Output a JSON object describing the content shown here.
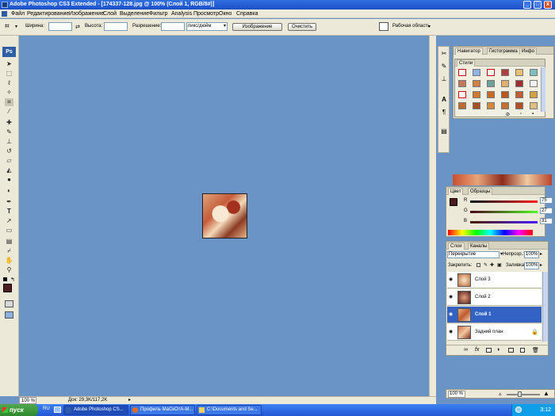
{
  "window": {
    "title": "Adobe Photoshop CS3 Extended - [174337-128.jpg @ 100% (Слой 1, RGB/8#)]",
    "minimize": "_",
    "maximize": "□",
    "close": "x"
  },
  "menu": [
    "Файл",
    "Редактирование",
    "Изображение",
    "Слой",
    "Выделение",
    "Фильтр",
    "Analysis",
    "Просмотр",
    "Окно",
    "Справка"
  ],
  "options": {
    "width_label": "Ширина:",
    "height_label": "Высота:",
    "resolution_label": "Разрешение:",
    "units": "пикс/дюйм",
    "image_button": "Изображение",
    "clear_button": "Очистить",
    "workspace": "Рабочая область"
  },
  "toolbox": {
    "logo": "Ps"
  },
  "status": {
    "zoom": "100 %",
    "doc": "Док: 29,3K/117,2K"
  },
  "navigator": {
    "tabs": [
      "Навигатор",
      "Гистограмма",
      "Инфо"
    ]
  },
  "styles": {
    "tab": "Стили"
  },
  "color": {
    "tabs": [
      "Цвет",
      "Образцы"
    ],
    "r_label": "R",
    "g_label": "G",
    "b_label": "B",
    "r": "75",
    "g": "27",
    "b": "31",
    "swatch": "#4b1b1f"
  },
  "layers": {
    "tabs": [
      "Слои",
      "Каналы"
    ],
    "blend_mode": "Перекрытие",
    "opacity_label": "Непрозр.:",
    "opacity": "100%",
    "lock_label": "Закрепить:",
    "fill_label": "Заливка:",
    "fill": "100%",
    "items": [
      {
        "name": "Слой 3",
        "selected": false
      },
      {
        "name": "Слой 2",
        "selected": false
      },
      {
        "name": "Слой 1",
        "selected": true
      },
      {
        "name": "Задний план",
        "selected": false
      }
    ]
  },
  "bottom_panel": {
    "zoom": "100 %"
  },
  "taskbar": {
    "start": "пуск",
    "lang": "RU",
    "items": [
      "Adobe Photoshop CS...",
      "Профиль МаСкОтА-М...",
      "C:\\Documents and Se..."
    ],
    "clock": "3:12"
  }
}
